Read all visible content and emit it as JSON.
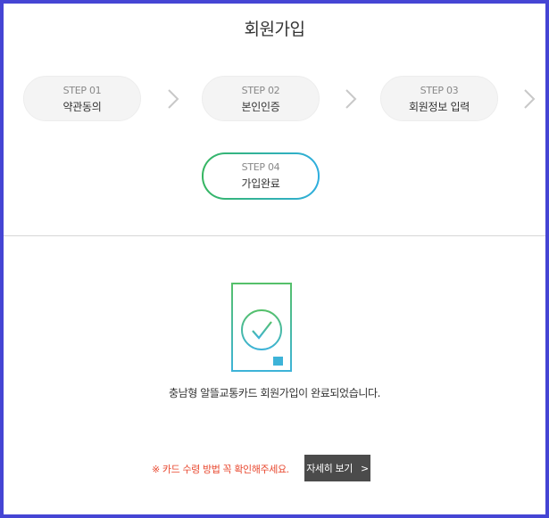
{
  "page_title": "회원가입",
  "steps": [
    {
      "num": "STEP 01",
      "name": "약관동의"
    },
    {
      "num": "STEP 02",
      "name": "본인인증"
    },
    {
      "num": "STEP 03",
      "name": "회원정보 입력"
    },
    {
      "num": "STEP 04",
      "name": "가입완료"
    }
  ],
  "active_step": 4,
  "icon": "document-check-icon",
  "completion_message": "충남형 알뜰교통카드 회원가입이 완료되었습니다.",
  "notice": "※ 카드 수령 방법 꼭 확인해주세요.",
  "detail_button": {
    "label": "자세히 보기",
    "arrow": ">"
  },
  "colors": {
    "border": "#4545d4",
    "accent_green": "#36b660",
    "accent_blue": "#2eaee0",
    "notice": "#e8472e",
    "button_bg": "#4b4b4b"
  }
}
